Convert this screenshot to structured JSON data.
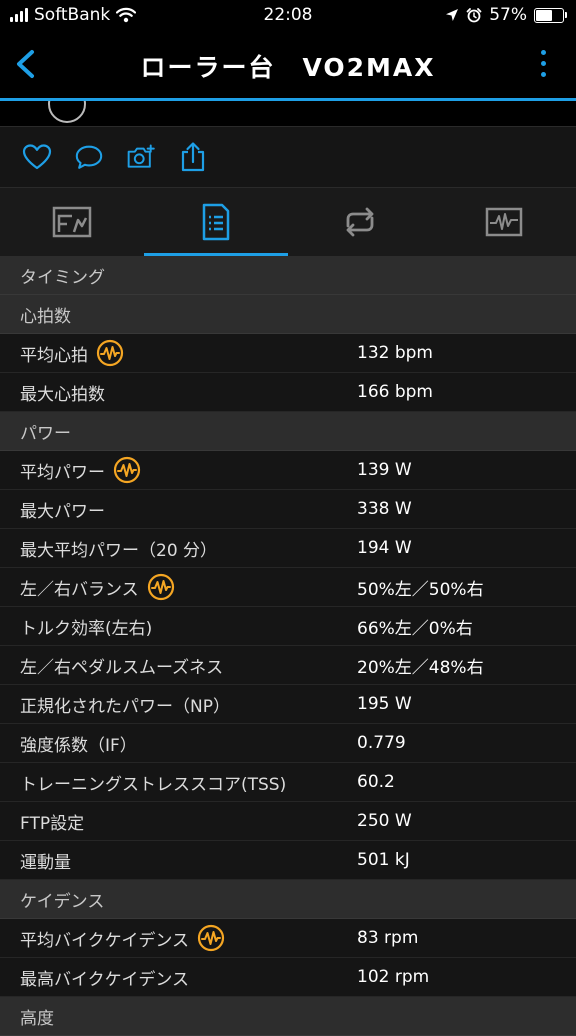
{
  "status_bar": {
    "carrier": "SoftBank",
    "time": "22:08",
    "battery": "57%"
  },
  "nav": {
    "title": "ローラー台　VO2MAX"
  },
  "tabs": [
    {
      "name": "tab-overview",
      "icon": "chart-card-icon"
    },
    {
      "name": "tab-stats",
      "icon": "document-list-icon"
    },
    {
      "name": "tab-laps",
      "icon": "repeat-icon"
    },
    {
      "name": "tab-graphs",
      "icon": "waveform-icon"
    }
  ],
  "sections": {
    "timing": {
      "title": "タイミング"
    },
    "hr": {
      "title": "心拍数",
      "rows": [
        {
          "label": "平均心拍",
          "value": "132 bpm"
        },
        {
          "label": "最大心拍数",
          "value": "166 bpm"
        }
      ]
    },
    "power": {
      "title": "パワー",
      "rows": [
        {
          "label": "平均パワー",
          "value": "139 W"
        },
        {
          "label": "最大パワー",
          "value": "338 W"
        },
        {
          "label": "最大平均パワー（20 分）",
          "value": "194 W"
        },
        {
          "label": "左／右バランス",
          "value": "50%左／50%右"
        },
        {
          "label": "トルク効率(左右)",
          "value": "66%左／0%右"
        },
        {
          "label": "左／右ペダルスムーズネス",
          "value": "20%左／48%右"
        },
        {
          "label": "正規化されたパワー（NP）",
          "value": "195 W"
        },
        {
          "label": "強度係数（IF）",
          "value": "0.779"
        },
        {
          "label": "トレーニングストレススコア(TSS)",
          "value": "60.2"
        },
        {
          "label": "FTP設定",
          "value": "250 W"
        },
        {
          "label": "運動量",
          "value": "501 kJ"
        }
      ]
    },
    "cadence": {
      "title": "ケイデンス",
      "rows": [
        {
          "label": "平均バイクケイデンス",
          "value": "83 rpm"
        },
        {
          "label": "最高バイクケイデンス",
          "value": "102 rpm"
        }
      ]
    },
    "altitude": {
      "title": "高度"
    }
  },
  "colors": {
    "accent": "#1E9FE6",
    "badge": "#F5A623"
  }
}
